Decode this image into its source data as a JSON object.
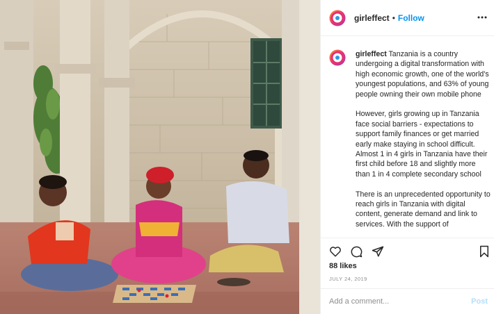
{
  "post": {
    "username": "girleffect",
    "separator": "•",
    "follow_label": "Follow",
    "more_icon": "more-options-icon",
    "caption_paragraphs": [
      "Tanzania is a country undergoing a digital transformation with high economic growth, one of the world's youngest populations, and 63% of young people owning their own mobile phone",
      "However, girls growing up in Tanzania face social barriers - expectations to support family finances or get married early make staying in school difficult. Almost 1 in 4 girls in Tanzania have their first child before 18 and slightly more than 1 in 4 complete secondary school",
      "There is an unprecedented opportunity to reach girls in Tanzania with digital content, generate demand and link to services. With the support of"
    ],
    "likes_text": "88 likes",
    "date_text": "JULY 24, 2019",
    "comment_placeholder": "Add a comment...",
    "post_label": "Post",
    "action_icons": [
      "heart-icon",
      "comment-icon",
      "share-icon",
      "bookmark-icon"
    ]
  },
  "colors": {
    "follow_blue": "#0095f6",
    "post_disabled_blue": "#b2dffc",
    "muted_gray": "#8e8e8e",
    "text_dark": "#262626",
    "border": "#efefef"
  }
}
